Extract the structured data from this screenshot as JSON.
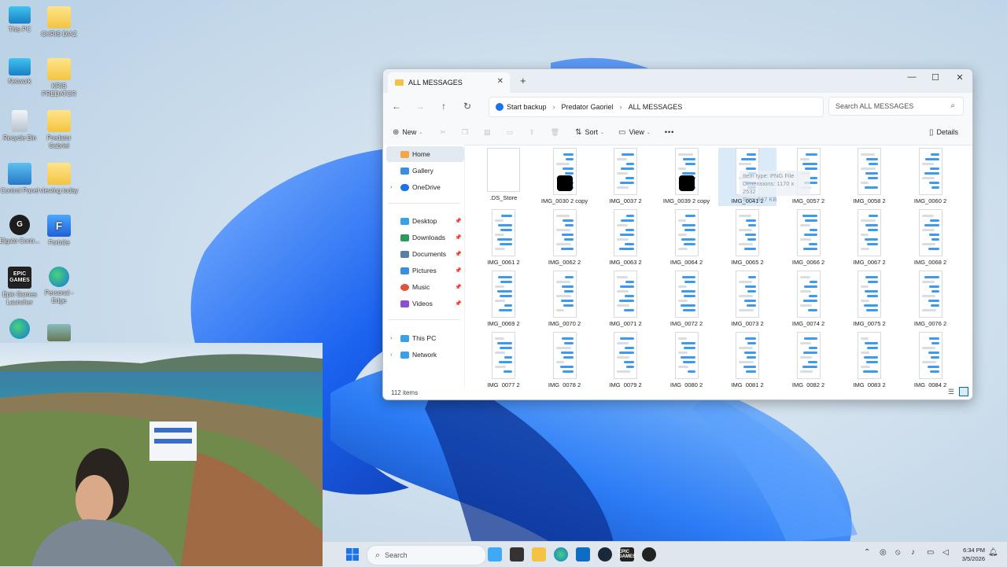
{
  "desktop": {
    "icons": [
      {
        "label": "This PC"
      },
      {
        "label": "CHRIS DIAZ"
      },
      {
        "label": "Network"
      },
      {
        "label": "KRIS PREDATOR"
      },
      {
        "label": "Recycle Bin"
      },
      {
        "label": "Predator Gabriel"
      },
      {
        "label": "Control Panel"
      },
      {
        "label": "viewing today"
      },
      {
        "label": "Elgato Contr..."
      },
      {
        "label": "Fortnite"
      },
      {
        "label": "Epic Games Launcher"
      },
      {
        "label": "Personal - Edge"
      }
    ],
    "epic_logo_text": "EPIC GAMES"
  },
  "explorer": {
    "tab_title": "ALL MESSAGES",
    "new_tab": "+",
    "window_controls": {
      "minimize": "—",
      "maximize": "☐",
      "close": "✕"
    },
    "nav": {
      "back": "←",
      "forward": "→",
      "up": "↑",
      "refresh": "↻"
    },
    "breadcrumb": [
      "Start backup",
      "Predator Gaoriel",
      "ALL MESSAGES"
    ],
    "search_placeholder": "Search ALL MESSAGES",
    "commands": {
      "new": "New",
      "sort": "Sort",
      "view": "View",
      "more": "•••",
      "details": "Details"
    },
    "sidebar": {
      "home": "Home",
      "gallery": "Gallery",
      "onedrive": "OneDrive",
      "desktop": "Desktop",
      "downloads": "Downloads",
      "documents": "Documents",
      "pictures": "Pictures",
      "music": "Music",
      "videos": "Videos",
      "thispc": "This PC",
      "network": "Network"
    },
    "files": [
      ".DS_Store",
      "IMG_0030 2 copy",
      "IMG_0037 2",
      "IMG_0039 2 copy",
      "IMG_0041 2",
      "IMG_0057 2",
      "IMG_0058 2",
      "IMG_0060 2",
      "IMG_0061 2",
      "IMG_0062 2",
      "IMG_0063 2",
      "IMG_0064 2",
      "IMG_0065 2",
      "IMG_0066 2",
      "IMG_0067 2",
      "IMG_0068 2",
      "IMG_0069 2",
      "IMG_0070 2",
      "IMG_0071 2",
      "IMG_0072 2",
      "IMG_0073 2",
      "IMG_0074 2",
      "IMG_0075 2",
      "IMG_0076 2",
      "IMG_0077 2",
      "IMG_0078 2",
      "IMG_0079 2",
      "IMG_0080 2",
      "IMG_0081 2",
      "IMG_0082 2",
      "IMG_0083 2",
      "IMG_0084 2"
    ],
    "tooltip": {
      "type": "Item type: PNG File",
      "dims": "Dimensions: 1170 x 2532",
      "size": "Size: 847 KB"
    },
    "status": "112 items"
  },
  "taskbar": {
    "search": "Search",
    "time": "6:34 PM",
    "date": "3/5/2026"
  },
  "colors": {
    "bubble_blue": "#3b9af2",
    "bubble_gray": "#d9dde2",
    "accent": "#0067c0"
  }
}
